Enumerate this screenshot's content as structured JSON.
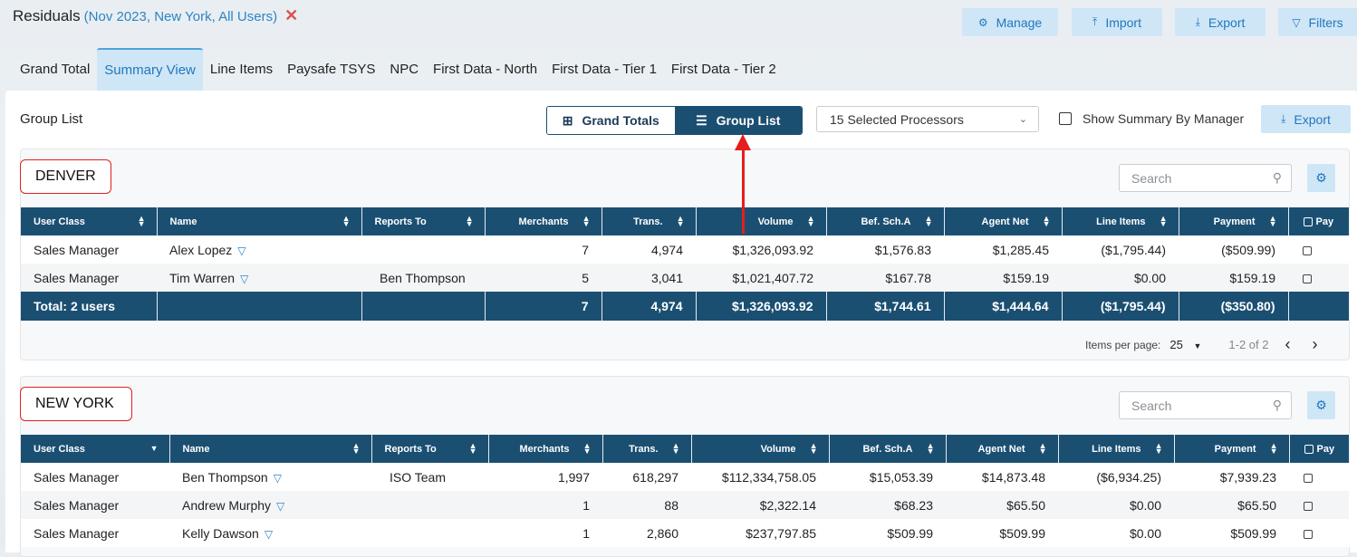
{
  "header": {
    "title": "Residuals",
    "context": "(Nov 2023, New York, All Users)",
    "clear_icon": "close-icon"
  },
  "toolbar": {
    "manage": "Manage",
    "import": "Import",
    "export": "Export",
    "filters": "Filters"
  },
  "tabs": [
    "Grand Total",
    "Summary View",
    "Line Items",
    "Paysafe TSYS",
    "NPC",
    "First Data - North",
    "First Data - Tier 1",
    "First Data - Tier 2"
  ],
  "active_tab": "Summary View",
  "controls": {
    "group_list_label": "Group List",
    "grand_totals": "Grand Totals",
    "group_list": "Group List",
    "processors": "15 Selected Processors",
    "show_summary": "Show Summary By Manager",
    "export": "Export"
  },
  "columns": [
    "User Class",
    "Name",
    "Reports To",
    "Merchants",
    "Trans.",
    "Volume",
    "Bef. Sch.A",
    "Agent Net",
    "Line Items",
    "Payment",
    "Pay"
  ],
  "groups": {
    "denver": {
      "name": "DENVER",
      "search_placeholder": "Search",
      "rows": [
        [
          "Sales Manager",
          "Alex Lopez",
          "",
          "7",
          "4,974",
          "$1,326,093.92",
          "$1,576.83",
          "$1,285.45",
          "($1,795.44)",
          "($509.99)"
        ],
        [
          "Sales Manager",
          "Tim Warren",
          "Ben Thompson",
          "5",
          "3,041",
          "$1,021,407.72",
          "$167.78",
          "$159.19",
          "$0.00",
          "$159.19"
        ]
      ],
      "total": [
        "Total: 2 users",
        "",
        "",
        "7",
        "4,974",
        "$1,326,093.92",
        "$1,744.61",
        "$1,444.64",
        "($1,795.44)",
        "($350.80)"
      ],
      "pager": {
        "items_label": "Items per page:",
        "per_page": "25",
        "range": "1-2 of 2"
      }
    },
    "newyork": {
      "name": "NEW YORK",
      "search_placeholder": "Search",
      "rows": [
        [
          "Sales Manager",
          "Ben Thompson",
          "ISO Team",
          "1,997",
          "618,297",
          "$112,334,758.05",
          "$15,053.39",
          "$14,873.48",
          "($6,934.25)",
          "$7,939.23"
        ],
        [
          "Sales Manager",
          "Andrew Murphy",
          "",
          "1",
          "88",
          "$2,322.14",
          "$68.23",
          "$65.50",
          "$0.00",
          "$65.50"
        ],
        [
          "Sales Manager",
          "Kelly Dawson",
          "",
          "1",
          "2,860",
          "$237,797.85",
          "$509.99",
          "$509.99",
          "$0.00",
          "$509.99"
        ]
      ]
    }
  },
  "colors": {
    "primary": "#1b4f72",
    "accent": "#1f78bd",
    "light": "#cfe6f7",
    "negative": "#c0392b",
    "highlight": "#e02020"
  }
}
